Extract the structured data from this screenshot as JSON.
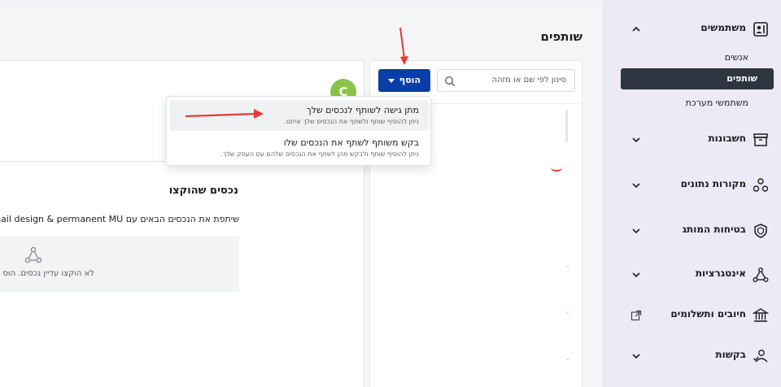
{
  "page": {
    "title": "שותפים"
  },
  "sidebar": {
    "groups": [
      {
        "label": "משתמשים",
        "icon": "users-icon",
        "expanded": true
      },
      {
        "label": "חשבונות",
        "icon": "archive-icon"
      },
      {
        "label": "מקורות נתונים",
        "icon": "data-sources-icon"
      },
      {
        "label": "בטיחות המותג",
        "icon": "shield-icon"
      },
      {
        "label": "אינטגרציות",
        "icon": "integrations-icon"
      },
      {
        "label": "חיובים ותשלומים",
        "icon": "bank-icon"
      },
      {
        "label": "בקשות",
        "icon": "user-check-icon"
      }
    ],
    "sub_items": [
      {
        "label": "אנשים"
      },
      {
        "label": "שותפים",
        "active": true
      },
      {
        "label": "משתמשי מערכת"
      }
    ]
  },
  "list": {
    "search_placeholder": "סינון לפי שם או מזהה",
    "add_button": "הוסף"
  },
  "dropdown": {
    "items": [
      {
        "title": "מתן גישה לשותף לנכסים שלך",
        "subtitle": "ניתן להוסיף שותף ולשתף את הנכסים שלך איתם."
      },
      {
        "title": "בקש משותף לשתף את הנכסים שלו",
        "subtitle": "ניתן להוסיף שותף ולבקש מהן לשתף את הנכסים שלהם עם העסק שלך."
      }
    ]
  },
  "detail": {
    "avatar_letter": "C",
    "section_title": "נכסים שהוקצו",
    "share_text": "שיתפת את הנכסים הבאים עם nin nail design & permanent MU",
    "empty_text": "לא הוקצו עדיין נכסים. הוס"
  },
  "colors": {
    "primary": "#0b3ea8",
    "sidebar_active": "#2e3540",
    "avatar": "#8bc34a",
    "arrow": "#e53935"
  }
}
